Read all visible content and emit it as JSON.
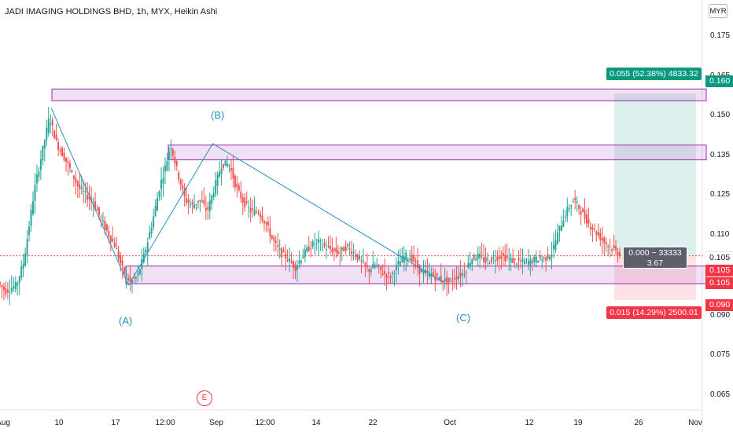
{
  "header": {
    "title": "JADI IMAGING HOLDINGS BHD, 1h, MYX, Heikin Ashi",
    "currency": "MYR"
  },
  "colors": {
    "up": "#26a69a",
    "down": "#ef5350",
    "zone_fill": "#9c27b0",
    "wave_line": "#2a8fbd",
    "profit": "#089981",
    "loss": "#f23645",
    "calc_box": "#5d606b",
    "current_price_line": "#ef5350"
  },
  "chart_data": {
    "type": "candlestick",
    "style": "Heikin Ashi",
    "symbol": "JADI IMAGING HOLDINGS BHD",
    "interval": "1h",
    "exchange": "MYX",
    "ylim": [
      0.057,
      0.181
    ],
    "y_ticks": [
      "0.175",
      "0.165",
      "0.150",
      "0.135",
      "0.125",
      "0.110",
      "0.090",
      "0.075",
      "0.065"
    ],
    "x_ticks": [
      "Aug",
      "10",
      "17",
      "12:00",
      "Sep",
      "12:00",
      "14",
      "22",
      "Oct",
      "12",
      "19",
      "26",
      "Nov"
    ],
    "grid": false,
    "path": [
      {
        "t": 0,
        "p": 0.096
      },
      {
        "t": 2,
        "p": 0.093
      },
      {
        "t": 5,
        "p": 0.095
      },
      {
        "t": 7,
        "p": 0.103
      },
      {
        "t": 10,
        "p": 0.128
      },
      {
        "t": 12,
        "p": 0.14
      },
      {
        "t": 14,
        "p": 0.152
      },
      {
        "t": 16,
        "p": 0.143
      },
      {
        "t": 19,
        "p": 0.136
      },
      {
        "t": 22,
        "p": 0.128
      },
      {
        "t": 26,
        "p": 0.123
      },
      {
        "t": 29,
        "p": 0.115
      },
      {
        "t": 32,
        "p": 0.108
      },
      {
        "t": 34,
        "p": 0.1
      },
      {
        "t": 36,
        "p": 0.096
      },
      {
        "t": 38,
        "p": 0.098
      },
      {
        "t": 40,
        "p": 0.106
      },
      {
        "t": 42,
        "p": 0.116
      },
      {
        "t": 44,
        "p": 0.128
      },
      {
        "t": 46,
        "p": 0.137
      },
      {
        "t": 47,
        "p": 0.143
      },
      {
        "t": 49,
        "p": 0.133
      },
      {
        "t": 51,
        "p": 0.124
      },
      {
        "t": 53,
        "p": 0.122
      },
      {
        "t": 55,
        "p": 0.124
      },
      {
        "t": 57,
        "p": 0.12
      },
      {
        "t": 59,
        "p": 0.128
      },
      {
        "t": 61,
        "p": 0.136
      },
      {
        "t": 63,
        "p": 0.136
      },
      {
        "t": 65,
        "p": 0.128
      },
      {
        "t": 67,
        "p": 0.123
      },
      {
        "t": 69,
        "p": 0.12
      },
      {
        "t": 71,
        "p": 0.12
      },
      {
        "t": 73,
        "p": 0.116
      },
      {
        "t": 75,
        "p": 0.11
      },
      {
        "t": 77,
        "p": 0.106
      },
      {
        "t": 79,
        "p": 0.104
      },
      {
        "t": 81,
        "p": 0.101
      },
      {
        "t": 83,
        "p": 0.105
      },
      {
        "t": 85,
        "p": 0.108
      },
      {
        "t": 87,
        "p": 0.11
      },
      {
        "t": 89,
        "p": 0.108
      },
      {
        "t": 91,
        "p": 0.107
      },
      {
        "t": 93,
        "p": 0.106
      },
      {
        "t": 95,
        "p": 0.108
      },
      {
        "t": 97,
        "p": 0.106
      },
      {
        "t": 99,
        "p": 0.103
      },
      {
        "t": 101,
        "p": 0.1
      },
      {
        "t": 103,
        "p": 0.102
      },
      {
        "t": 105,
        "p": 0.099
      },
      {
        "t": 107,
        "p": 0.098
      },
      {
        "t": 109,
        "p": 0.102
      },
      {
        "t": 111,
        "p": 0.105
      },
      {
        "t": 113,
        "p": 0.104
      },
      {
        "t": 115,
        "p": 0.1
      },
      {
        "t": 117,
        "p": 0.099
      },
      {
        "t": 119,
        "p": 0.098
      },
      {
        "t": 121,
        "p": 0.097
      },
      {
        "t": 123,
        "p": 0.096
      },
      {
        "t": 125,
        "p": 0.098
      },
      {
        "t": 127,
        "p": 0.099
      },
      {
        "t": 129,
        "p": 0.104
      },
      {
        "t": 131,
        "p": 0.105
      },
      {
        "t": 133,
        "p": 0.103
      },
      {
        "t": 135,
        "p": 0.104
      },
      {
        "t": 137,
        "p": 0.105
      },
      {
        "t": 139,
        "p": 0.104
      },
      {
        "t": 141,
        "p": 0.103
      },
      {
        "t": 143,
        "p": 0.103
      },
      {
        "t": 145,
        "p": 0.103
      },
      {
        "t": 147,
        "p": 0.104
      },
      {
        "t": 149,
        "p": 0.104
      },
      {
        "t": 151,
        "p": 0.106
      },
      {
        "t": 153,
        "p": 0.114
      },
      {
        "t": 155,
        "p": 0.12
      },
      {
        "t": 157,
        "p": 0.124
      },
      {
        "t": 159,
        "p": 0.12
      },
      {
        "t": 161,
        "p": 0.116
      },
      {
        "t": 163,
        "p": 0.113
      },
      {
        "t": 165,
        "p": 0.11
      },
      {
        "t": 167,
        "p": 0.108
      },
      {
        "t": 169,
        "p": 0.106
      }
    ],
    "zones": [
      {
        "top": 0.1615,
        "bottom": 0.1575
      },
      {
        "top": 0.1425,
        "bottom": 0.1375
      },
      {
        "top": 0.1015,
        "bottom": 0.0955
      }
    ],
    "wave_points": [
      {
        "t": 14,
        "p": 0.155
      },
      {
        "t": 35,
        "p": 0.095
      },
      {
        "t": 58,
        "p": 0.143
      },
      {
        "t": 121,
        "p": 0.096
      }
    ],
    "wave_labels": [
      "(A)",
      "(B)",
      "(C)"
    ],
    "event_marker": "E",
    "current_price": 0.105,
    "position": {
      "type": "long",
      "entry": 0.105,
      "target": 0.16,
      "stop": 0.09,
      "target_label": "0.055 (52.38%) 4833.32",
      "stop_label": "0.015 (14.29%) 2500.01",
      "calc_line1": "0.000 ~ 33333",
      "calc_line2": "3.67"
    },
    "axis_tags": [
      {
        "label": "0.160",
        "value": 0.16,
        "kind": "profit"
      },
      {
        "label": "0.105",
        "value": 0.105,
        "kind": "current"
      },
      {
        "label": "0.105",
        "value": 0.105,
        "kind": "entry"
      },
      {
        "label": "0.105",
        "value": 0.105,
        "kind": "entry2"
      },
      {
        "label": "0.090",
        "value": 0.09,
        "kind": "loss"
      }
    ]
  }
}
